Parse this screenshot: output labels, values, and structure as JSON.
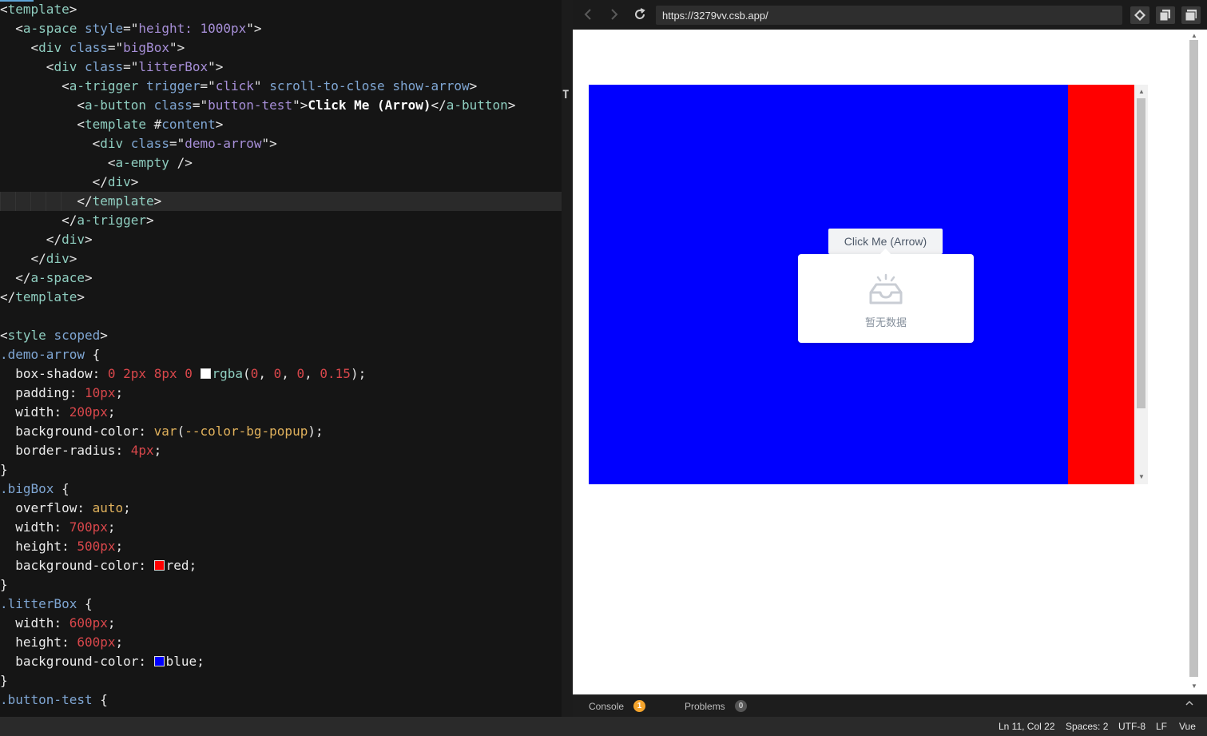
{
  "editor": {
    "lines": [
      [
        [
          "t-punc",
          "<"
        ],
        [
          "t-tag",
          "template"
        ],
        [
          "t-punc",
          ">"
        ]
      ],
      [
        [
          "t-punc",
          "  <"
        ],
        [
          "t-tag",
          "a-space"
        ],
        [
          "t-punc",
          " "
        ],
        [
          "t-attr",
          "style"
        ],
        [
          "t-punc",
          "=\""
        ],
        [
          "t-str",
          "height: 1000px"
        ],
        [
          "t-punc",
          "\">"
        ]
      ],
      [
        [
          "t-punc",
          "    <"
        ],
        [
          "t-tag",
          "div"
        ],
        [
          "t-punc",
          " "
        ],
        [
          "t-attr",
          "class"
        ],
        [
          "t-punc",
          "=\""
        ],
        [
          "t-str",
          "bigBox"
        ],
        [
          "t-punc",
          "\">"
        ]
      ],
      [
        [
          "t-punc",
          "      <"
        ],
        [
          "t-tag",
          "div"
        ],
        [
          "t-punc",
          " "
        ],
        [
          "t-attr",
          "class"
        ],
        [
          "t-punc",
          "=\""
        ],
        [
          "t-str",
          "litterBox"
        ],
        [
          "t-punc",
          "\">"
        ]
      ],
      [
        [
          "t-punc",
          "        <"
        ],
        [
          "t-tag",
          "a-trigger"
        ],
        [
          "t-punc",
          " "
        ],
        [
          "t-attr",
          "trigger"
        ],
        [
          "t-punc",
          "=\""
        ],
        [
          "t-str",
          "click"
        ],
        [
          "t-punc",
          "\" "
        ],
        [
          "t-attr",
          "scroll-to-close"
        ],
        [
          "t-punc",
          " "
        ],
        [
          "t-attr",
          "show-arrow"
        ],
        [
          "t-punc",
          ">"
        ]
      ],
      [
        [
          "t-punc",
          "          <"
        ],
        [
          "t-tag",
          "a-button"
        ],
        [
          "t-punc",
          " "
        ],
        [
          "t-attr",
          "class"
        ],
        [
          "t-punc",
          "=\""
        ],
        [
          "t-str",
          "button-test"
        ],
        [
          "t-punc",
          "\">"
        ],
        [
          "t-text",
          "Click Me (Arrow)"
        ],
        [
          "t-punc",
          "</"
        ],
        [
          "t-tag",
          "a-button"
        ],
        [
          "t-punc",
          ">"
        ]
      ],
      [
        [
          "t-punc",
          "          <"
        ],
        [
          "t-tag",
          "template"
        ],
        [
          "t-punc",
          " #"
        ],
        [
          "t-attr",
          "content"
        ],
        [
          "t-punc",
          ">"
        ]
      ],
      [
        [
          "t-punc",
          "            <"
        ],
        [
          "t-tag",
          "div"
        ],
        [
          "t-punc",
          " "
        ],
        [
          "t-attr",
          "class"
        ],
        [
          "t-punc",
          "=\""
        ],
        [
          "t-str",
          "demo-arrow"
        ],
        [
          "t-punc",
          "\">"
        ]
      ],
      [
        [
          "t-punc",
          "              <"
        ],
        [
          "t-tag",
          "a-empty"
        ],
        [
          "t-punc",
          " />"
        ]
      ],
      [
        [
          "t-punc",
          "            </"
        ],
        [
          "t-tag",
          "div"
        ],
        [
          "t-punc",
          ">"
        ]
      ],
      [
        [
          "t-punc",
          "          </"
        ],
        [
          "t-tag",
          "template"
        ],
        [
          "t-punc",
          ">"
        ]
      ],
      [
        [
          "t-punc",
          "        </"
        ],
        [
          "t-tag",
          "a-trigger"
        ],
        [
          "t-punc",
          ">"
        ]
      ],
      [
        [
          "t-punc",
          "      </"
        ],
        [
          "t-tag",
          "div"
        ],
        [
          "t-punc",
          ">"
        ]
      ],
      [
        [
          "t-punc",
          "    </"
        ],
        [
          "t-tag",
          "div"
        ],
        [
          "t-punc",
          ">"
        ]
      ],
      [
        [
          "t-punc",
          "  </"
        ],
        [
          "t-tag",
          "a-space"
        ],
        [
          "t-punc",
          ">"
        ]
      ],
      [
        [
          "t-punc",
          "</"
        ],
        [
          "t-tag",
          "template"
        ],
        [
          "t-punc",
          ">"
        ]
      ],
      [
        [
          "t-punc",
          ""
        ]
      ],
      [
        [
          "t-punc",
          "<"
        ],
        [
          "t-tag",
          "style"
        ],
        [
          "t-punc",
          " "
        ],
        [
          "t-attr",
          "scoped"
        ],
        [
          "t-punc",
          ">"
        ]
      ],
      [
        [
          "t-sel",
          ".demo-arrow"
        ],
        [
          "t-punc",
          " {"
        ]
      ],
      [
        [
          "t-prop",
          "  box-shadow"
        ],
        [
          "t-punc",
          ": "
        ],
        [
          "t-num",
          "0"
        ],
        [
          "t-punc",
          " "
        ],
        [
          "t-num",
          "2px"
        ],
        [
          "t-punc",
          " "
        ],
        [
          "t-num",
          "8px"
        ],
        [
          "t-punc",
          " "
        ],
        [
          "t-num",
          "0"
        ],
        [
          "t-punc",
          " "
        ],
        [
          "swatch",
          "#ffffff"
        ],
        [
          "t-fn",
          "rgba"
        ],
        [
          "t-punc",
          "("
        ],
        [
          "t-num",
          "0"
        ],
        [
          "t-punc",
          ", "
        ],
        [
          "t-num",
          "0"
        ],
        [
          "t-punc",
          ", "
        ],
        [
          "t-num",
          "0"
        ],
        [
          "t-punc",
          ", "
        ],
        [
          "t-num",
          "0.15"
        ],
        [
          "t-punc",
          ");"
        ]
      ],
      [
        [
          "t-prop",
          "  padding"
        ],
        [
          "t-punc",
          ": "
        ],
        [
          "t-num",
          "10px"
        ],
        [
          "t-punc",
          ";"
        ]
      ],
      [
        [
          "t-prop",
          "  width"
        ],
        [
          "t-punc",
          ": "
        ],
        [
          "t-num",
          "200px"
        ],
        [
          "t-punc",
          ";"
        ]
      ],
      [
        [
          "t-prop",
          "  background-color"
        ],
        [
          "t-punc",
          ": "
        ],
        [
          "t-kw",
          "var"
        ],
        [
          "t-punc",
          "("
        ],
        [
          "t-kw",
          "--color-bg-popup"
        ],
        [
          "t-punc",
          ");"
        ]
      ],
      [
        [
          "t-prop",
          "  border-radius"
        ],
        [
          "t-punc",
          ": "
        ],
        [
          "t-num",
          "4px"
        ],
        [
          "t-punc",
          ";"
        ]
      ],
      [
        [
          "t-punc",
          "}"
        ]
      ],
      [
        [
          "t-sel",
          ".bigBox"
        ],
        [
          "t-punc",
          " {"
        ]
      ],
      [
        [
          "t-prop",
          "  overflow"
        ],
        [
          "t-punc",
          ": "
        ],
        [
          "t-kw",
          "auto"
        ],
        [
          "t-punc",
          ";"
        ]
      ],
      [
        [
          "t-prop",
          "  width"
        ],
        [
          "t-punc",
          ": "
        ],
        [
          "t-num",
          "700px"
        ],
        [
          "t-punc",
          ";"
        ]
      ],
      [
        [
          "t-prop",
          "  height"
        ],
        [
          "t-punc",
          ": "
        ],
        [
          "t-num",
          "500px"
        ],
        [
          "t-punc",
          ";"
        ]
      ],
      [
        [
          "t-prop",
          "  background-color"
        ],
        [
          "t-punc",
          ": "
        ],
        [
          "swatch",
          "#ff0000"
        ],
        [
          "t-prop",
          "red"
        ],
        [
          "t-punc",
          ";"
        ]
      ],
      [
        [
          "t-punc",
          "}"
        ]
      ],
      [
        [
          "t-sel",
          ".litterBox"
        ],
        [
          "t-punc",
          " {"
        ]
      ],
      [
        [
          "t-prop",
          "  width"
        ],
        [
          "t-punc",
          ": "
        ],
        [
          "t-num",
          "600px"
        ],
        [
          "t-punc",
          ";"
        ]
      ],
      [
        [
          "t-prop",
          "  height"
        ],
        [
          "t-punc",
          ": "
        ],
        [
          "t-num",
          "600px"
        ],
        [
          "t-punc",
          ";"
        ]
      ],
      [
        [
          "t-prop",
          "  background-color"
        ],
        [
          "t-punc",
          ": "
        ],
        [
          "swatch",
          "#0000ff"
        ],
        [
          "t-prop",
          "blue"
        ],
        [
          "t-punc",
          ";"
        ]
      ],
      [
        [
          "t-punc",
          "}"
        ]
      ],
      [
        [
          "t-sel",
          ".button-test"
        ],
        [
          "t-punc",
          " {"
        ]
      ],
      [
        [
          "t-prop",
          "  "
        ],
        [
          "t-num",
          ""
        ]
      ]
    ],
    "active_line": 10,
    "colors": {
      "background": "#151515",
      "active_line": "#2a2a2a"
    }
  },
  "browser": {
    "url": "https://3279vv.csb.app/",
    "nav": {
      "back_icon": "chevron-left-icon",
      "forward_icon": "chevron-right-icon",
      "reload_icon": "reload-icon"
    },
    "tools": [
      "codesandbox-icon",
      "open-new-window-icon",
      "toggle-panel-icon"
    ]
  },
  "preview": {
    "big_box_color": "#ff0000",
    "litter_box_color": "#0000ff",
    "button_label": "Click Me (Arrow)",
    "empty_text": "暂无数据",
    "empty_icon": "empty-inbox-icon"
  },
  "panels": {
    "console_label": "Console",
    "console_count": "1",
    "problems_label": "Problems",
    "problems_count": "0"
  },
  "status": {
    "position": "Ln 11, Col 22",
    "spaces": "Spaces: 2",
    "encoding": "UTF-8",
    "eol": "LF",
    "language": "Vue"
  }
}
